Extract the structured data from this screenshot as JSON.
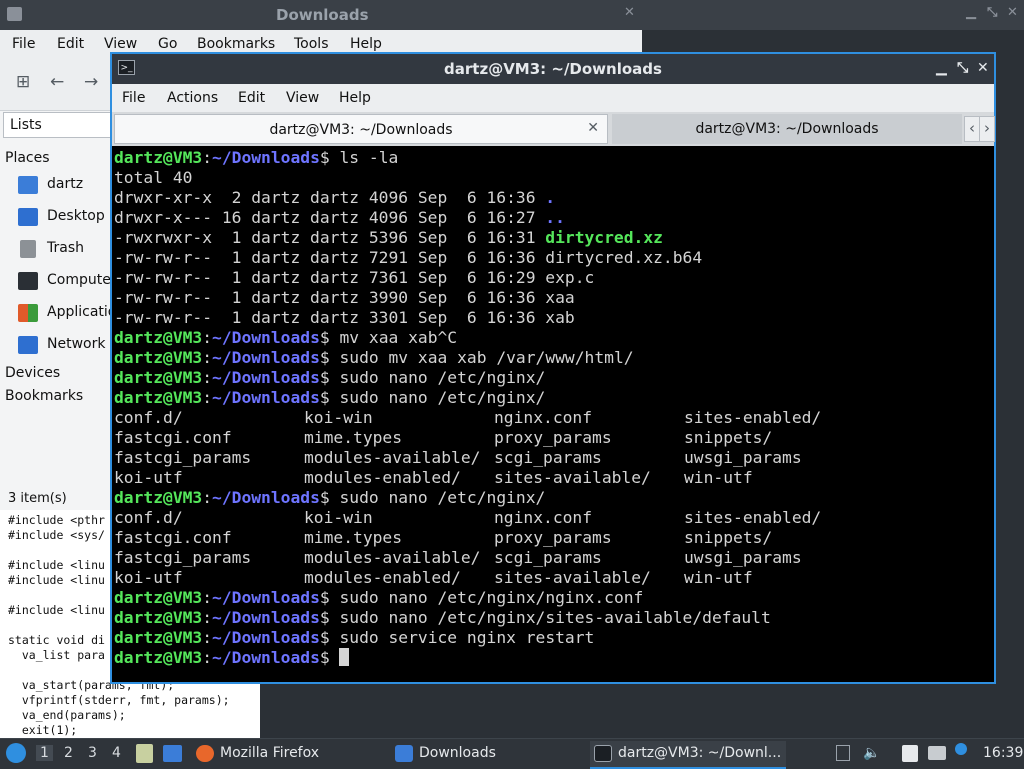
{
  "file_manager": {
    "title": "Downloads",
    "menu": [
      "File",
      "Edit",
      "View",
      "Go",
      "Bookmarks",
      "Tools",
      "Help"
    ],
    "lists_label": "Lists",
    "places_heading": "Places",
    "places": [
      {
        "label": "dartz",
        "icon": "home-folder-icon",
        "color": "#3b7dd8"
      },
      {
        "label": "Desktop",
        "icon": "desktop-icon",
        "color": "#2e6fd0"
      },
      {
        "label": "Trash",
        "icon": "trash-icon",
        "color": "#8c9196"
      },
      {
        "label": "Computer",
        "icon": "computer-icon",
        "color": "#2a2f35"
      },
      {
        "label": "Applications",
        "icon": "applications-icon",
        "color": "#e05a2a"
      },
      {
        "label": "Network",
        "icon": "network-icon",
        "color": "#2e6fd0"
      }
    ],
    "devices_heading": "Devices",
    "bookmarks_heading": "Bookmarks",
    "status": "3 item(s)"
  },
  "code_behind": {
    "lines": [
      "#include <pthr",
      "#include <sys/",
      "",
      "#include <linu",
      "#include <linu",
      "",
      "#include <linu",
      "",
      "static void di",
      "  va_list para"
    ],
    "wide_lines": [
      "  va_start(params, fmt);",
      "  vfprintf(stderr, fmt, params);",
      "  va_end(params);",
      "  exit(1);"
    ]
  },
  "terminal": {
    "title": "dartz@VM3: ~/Downloads",
    "menu": [
      "File",
      "Actions",
      "Edit",
      "View",
      "Help"
    ],
    "tabs": [
      "dartz@VM3: ~/Downloads",
      "dartz@VM3: ~/Downloads"
    ],
    "prompt": {
      "user": "dartz@VM3",
      "colon": ":",
      "path": "~/Downloads",
      "symbol": "$ "
    },
    "commands": {
      "ls": "ls -la",
      "mv": "mv xaa xab^C",
      "sudo_mv": "sudo mv xaa xab /var/www/html/",
      "nano_dir": "sudo nano /etc/nginx/",
      "nano_conf": "sudo nano /etc/nginx/nginx.conf",
      "nano_default": "sudo nano /etc/nginx/sites-available/default",
      "restart": "sudo service nginx restart"
    },
    "ls_output": {
      "total": "total 40",
      "rows": [
        {
          "meta": "drwxr-xr-x  2 dartz dartz 4096 Sep  6 16:36 ",
          "name": ".",
          "kind": "dir"
        },
        {
          "meta": "drwxr-x--- 16 dartz dartz 4096 Sep  6 16:27 ",
          "name": "..",
          "kind": "dir"
        },
        {
          "meta": "-rwxrwxr-x  1 dartz dartz 5396 Sep  6 16:31 ",
          "name": "dirtycred.xz",
          "kind": "exec"
        },
        {
          "meta": "-rw-rw-r--  1 dartz dartz 7291 Sep  6 16:36 ",
          "name": "dirtycred.xz.b64",
          "kind": "file"
        },
        {
          "meta": "-rw-rw-r--  1 dartz dartz 7361 Sep  6 16:29 ",
          "name": "exp.c",
          "kind": "file"
        },
        {
          "meta": "-rw-rw-r--  1 dartz dartz 3990 Sep  6 16:36 ",
          "name": "xaa",
          "kind": "file"
        },
        {
          "meta": "-rw-rw-r--  1 dartz dartz 3301 Sep  6 16:36 ",
          "name": "xab",
          "kind": "file"
        }
      ]
    },
    "completion": [
      [
        "conf.d/",
        "koi-win",
        "nginx.conf",
        "sites-enabled/"
      ],
      [
        "fastcgi.conf",
        "mime.types",
        "proxy_params",
        "snippets/"
      ],
      [
        "fastcgi_params",
        "modules-available/",
        "scgi_params",
        "uwsgi_params"
      ],
      [
        "koi-utf",
        "modules-enabled/",
        "sites-available/",
        "win-utf"
      ]
    ]
  },
  "taskbar": {
    "workspaces": [
      "1",
      "2",
      "3",
      "4"
    ],
    "tasks": [
      {
        "label": "Mozilla Firefox",
        "icon": "firefox-icon",
        "color": "#e8672b"
      },
      {
        "label": "Downloads",
        "icon": "folder-icon",
        "color": "#3b7dd8"
      },
      {
        "label": "dartz@VM3: ~/Downl...",
        "icon": "terminal-icon",
        "color": "#1b1f24"
      }
    ],
    "clock": "16:39"
  },
  "colors": {
    "prompt_user": "#55e75b",
    "prompt_path": "#6e74ff",
    "active_border": "#2f8fe0"
  }
}
